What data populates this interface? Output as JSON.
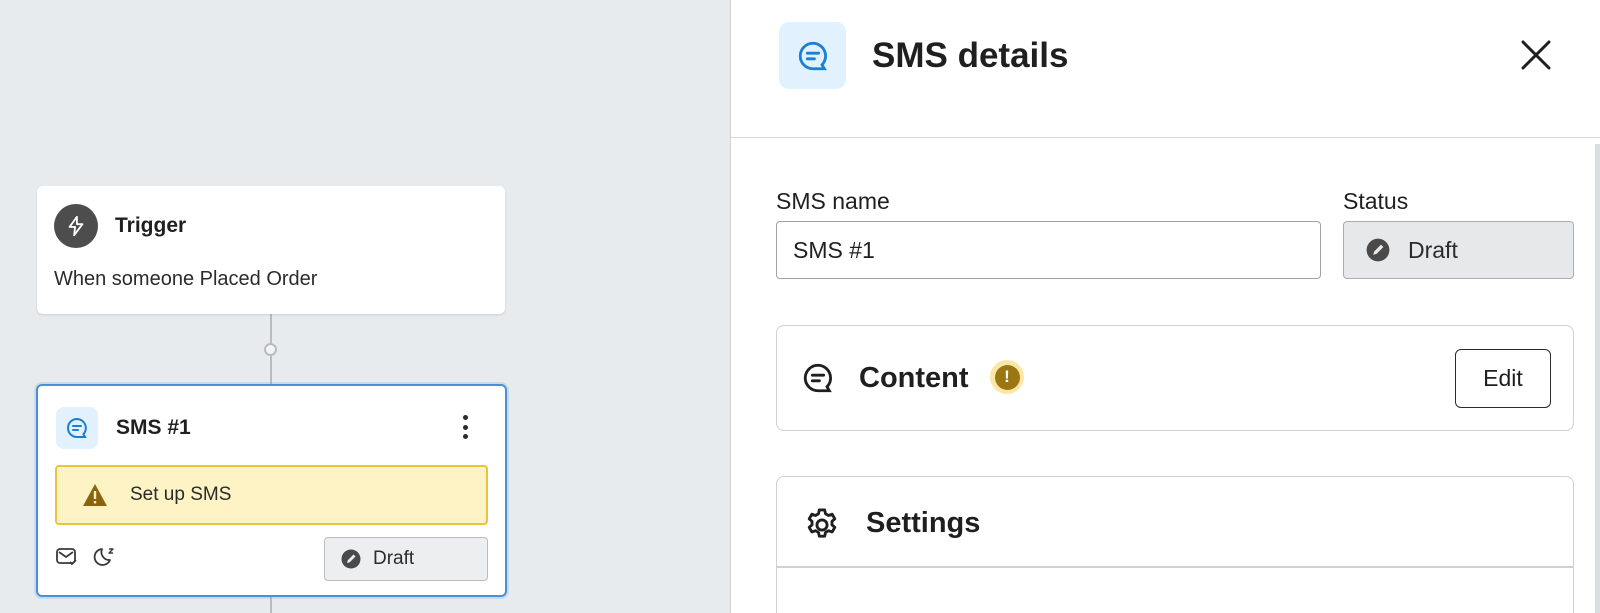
{
  "canvas": {
    "trigger": {
      "title": "Trigger",
      "description": "When someone Placed Order",
      "icon": "lightning-icon"
    },
    "sms_node": {
      "title": "SMS #1",
      "warning": "Set up SMS",
      "status": "Draft",
      "icons": [
        "sms-icon",
        "kebab-menu-icon",
        "warning-icon",
        "message-check-icon",
        "quiet-hours-moon-icon",
        "draft-status-icon"
      ]
    }
  },
  "panel": {
    "title": "SMS details",
    "sms_name_label": "SMS name",
    "sms_name_value": "SMS #1",
    "status_label": "Status",
    "status_value": "Draft",
    "content_title": "Content",
    "content_alert": "!",
    "edit_label": "Edit",
    "settings_title": "Settings"
  },
  "colors": {
    "accent_blue": "#4a90d9",
    "icon_bg": "#e1f1fd",
    "warning_bg": "#fdf3c4",
    "warning_border": "#e9c53a",
    "alert_badge": "#9c7612"
  }
}
